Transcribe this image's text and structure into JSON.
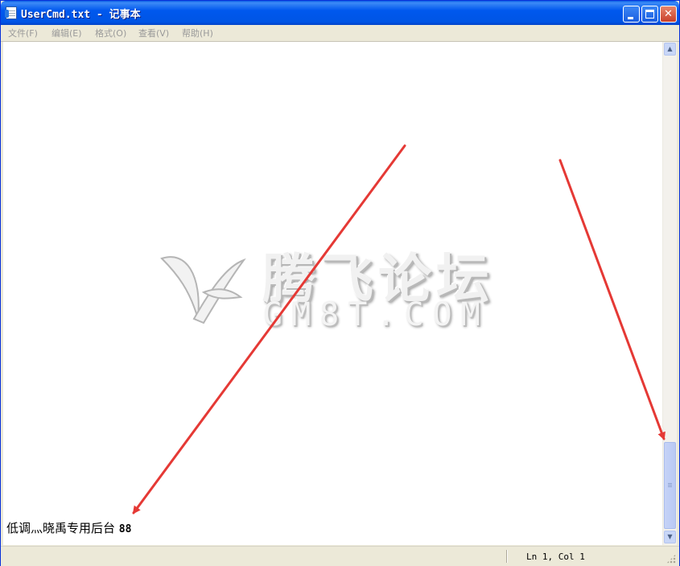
{
  "window": {
    "title": "UserCmd.txt - 记事本"
  },
  "menu": {
    "items": [
      {
        "label": "文件(F)"
      },
      {
        "label": "编辑(E)"
      },
      {
        "label": "格式(O)"
      },
      {
        "label": "查看(V)"
      },
      {
        "label": "帮助(H)"
      }
    ]
  },
  "editor": {
    "line_text": "低调灬晓禹专用后台",
    "line_number_text": "88"
  },
  "watermark": {
    "title": "腾飞论坛",
    "subtitle": "GM8T.COM"
  },
  "status": {
    "position": "Ln 1, Col 1"
  },
  "colors": {
    "titlebar": "#0055E5",
    "chrome": "#ECE9D8",
    "arrow": "#E53935"
  },
  "icons": {
    "app": "notepad-icon",
    "minimize": "minimize-icon",
    "maximize": "maximize-icon",
    "close": "close-icon"
  }
}
